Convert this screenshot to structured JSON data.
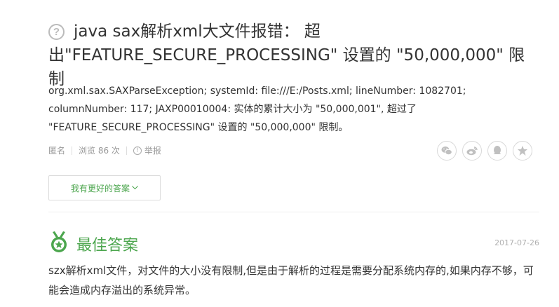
{
  "question": {
    "icon": "question-circle-icon",
    "title": "java sax解析xml大文件报错： 超出\"FEATURE_SECURE_PROCESSING\" 设置的 \"50,000,000\" 限制",
    "description": "org.xml.sax.SAXParseException; systemId: file:///E:/Posts.xml; lineNumber: 1082701; columnNumber: 117; JAXP00010004: 实体的累计大小为 \"50,000,001\", 超过了 \"FEATURE_SECURE_PROCESSING\" 设置的 \"50,000,000\" 限制。",
    "meta": {
      "author": "匿名",
      "views": "浏览 86 次",
      "report": "举报"
    },
    "share_icons": [
      "wechat-icon",
      "weibo-icon",
      "qq-icon",
      "qzone-icon"
    ],
    "better_answer_button": "我有更好的答案"
  },
  "best_answer": {
    "label": "最佳答案",
    "date": "2017-07-26",
    "text": "szx解析xml文件，对文件的大小没有限制,但是由于解析的过程是需要分配系统内存的,如果内存不够，可能会造成内存溢出的系统异常。"
  },
  "colors": {
    "accent_green": "#4ca64e",
    "muted_gray": "#999999",
    "text": "#333333"
  }
}
